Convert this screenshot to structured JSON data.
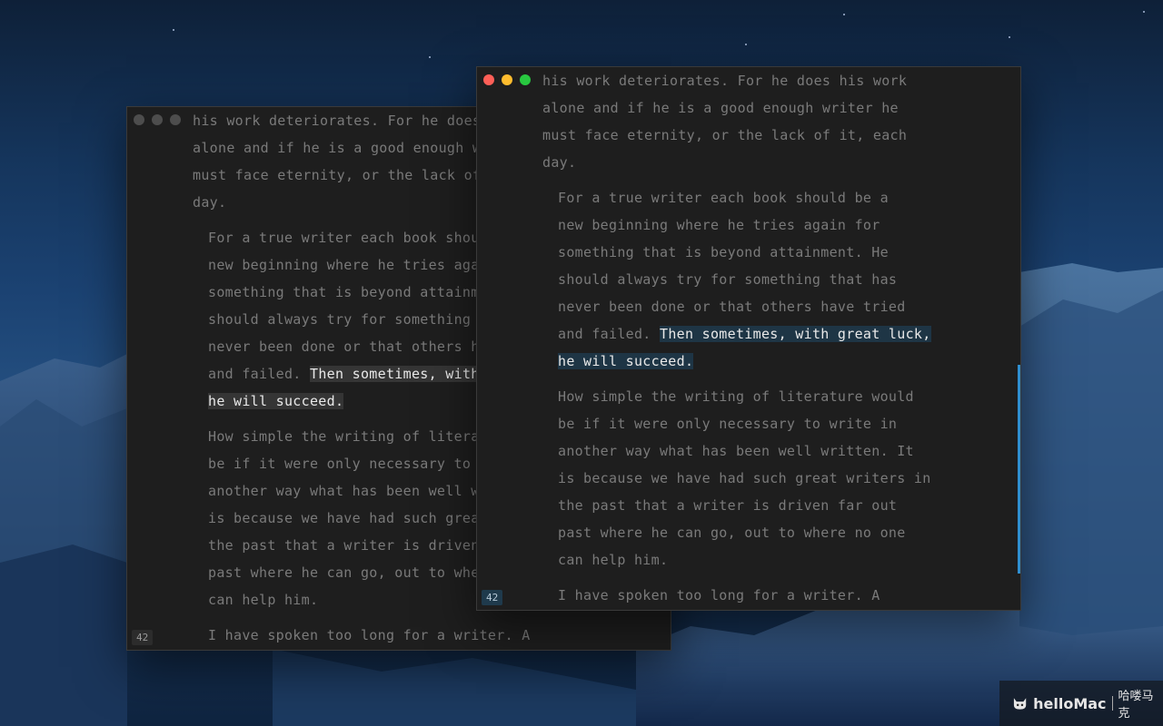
{
  "watermark": {
    "logo_text": "helloMac",
    "chinese_text": "哈喽马克"
  },
  "editor": {
    "word_count": "42",
    "paragraphs": [
      "his work deteriorates. For he does his work\nalone and if he is a good enough writer he\nmust face eternity, or the lack of it, each\nday.",
      "For a true writer each book should be a\nnew beginning where he tries again for\nsomething that is beyond attainment. He\nshould always try for something that has\nnever been done or that others have tried\nand failed. ",
      "How simple the writing of literature would\nbe if it were only necessary to write in\nanother way what has been well written. It\nis because we have had such great writers in\nthe past that a writer is driven far out\npast where he can go, out to where no one\ncan help him.",
      "I have spoken too long for a writer. A"
    ],
    "highlight": "Then sometimes, with great luck,\nhe will succeed."
  },
  "colors": {
    "highlight_focused": "#1e3545",
    "highlight_unfocused": "#353535",
    "scrollbar": "#2f8fd0",
    "close": "#fe5f57",
    "minimize": "#febc2e",
    "zoom": "#28c840"
  }
}
